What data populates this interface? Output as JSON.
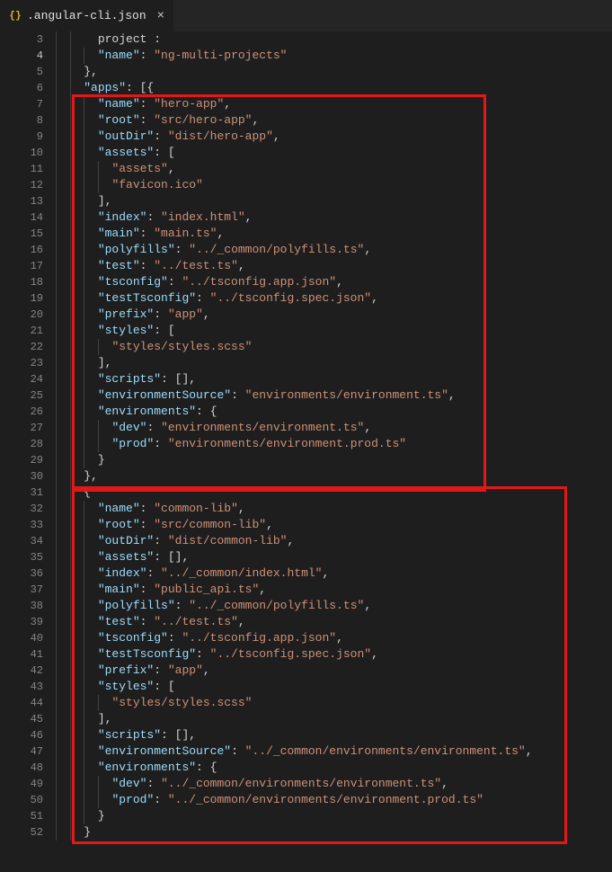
{
  "tab": {
    "icon_label": "{}",
    "filename": ".angular-cli.json",
    "close_glyph": "×"
  },
  "line_numbers_start": 3,
  "highlighted_gutter": 4,
  "lines": [
    {
      "n": 3,
      "ind": 2,
      "segs": [
        [
          "  ",
          null
        ],
        [
          "project",
          null
        ],
        [
          " : ",
          null
        ]
      ]
    },
    {
      "n": 4,
      "ind": 3,
      "segs": [
        [
          "\"name\"",
          "key"
        ],
        [
          ": ",
          "punct"
        ],
        [
          "\"ng-multi-projects\"",
          "str"
        ]
      ]
    },
    {
      "n": 5,
      "ind": 2,
      "segs": [
        [
          "},",
          "punct"
        ]
      ]
    },
    {
      "n": 6,
      "ind": 2,
      "segs": [
        [
          "\"apps\"",
          "key"
        ],
        [
          ": [{",
          "punct"
        ]
      ]
    },
    {
      "n": 7,
      "ind": 3,
      "segs": [
        [
          "\"name\"",
          "key"
        ],
        [
          ": ",
          "punct"
        ],
        [
          "\"hero-app\"",
          "str"
        ],
        [
          ",",
          "punct"
        ]
      ]
    },
    {
      "n": 8,
      "ind": 3,
      "segs": [
        [
          "\"root\"",
          "key"
        ],
        [
          ": ",
          "punct"
        ],
        [
          "\"src/hero-app\"",
          "str"
        ],
        [
          ",",
          "punct"
        ]
      ]
    },
    {
      "n": 9,
      "ind": 3,
      "segs": [
        [
          "\"outDir\"",
          "key"
        ],
        [
          ": ",
          "punct"
        ],
        [
          "\"dist/hero-app\"",
          "str"
        ],
        [
          ",",
          "punct"
        ]
      ]
    },
    {
      "n": 10,
      "ind": 3,
      "segs": [
        [
          "\"assets\"",
          "key"
        ],
        [
          ": [",
          "punct"
        ]
      ]
    },
    {
      "n": 11,
      "ind": 4,
      "segs": [
        [
          "\"assets\"",
          "str"
        ],
        [
          ",",
          "punct"
        ]
      ]
    },
    {
      "n": 12,
      "ind": 4,
      "segs": [
        [
          "\"favicon.ico\"",
          "str"
        ]
      ]
    },
    {
      "n": 13,
      "ind": 3,
      "segs": [
        [
          "],",
          "punct"
        ]
      ]
    },
    {
      "n": 14,
      "ind": 3,
      "segs": [
        [
          "\"index\"",
          "key"
        ],
        [
          ": ",
          "punct"
        ],
        [
          "\"index.html\"",
          "str"
        ],
        [
          ",",
          "punct"
        ]
      ]
    },
    {
      "n": 15,
      "ind": 3,
      "segs": [
        [
          "\"main\"",
          "key"
        ],
        [
          ": ",
          "punct"
        ],
        [
          "\"main.ts\"",
          "str"
        ],
        [
          ",",
          "punct"
        ]
      ]
    },
    {
      "n": 16,
      "ind": 3,
      "segs": [
        [
          "\"polyfills\"",
          "key"
        ],
        [
          ": ",
          "punct"
        ],
        [
          "\"../_common/polyfills.ts\"",
          "str"
        ],
        [
          ",",
          "punct"
        ]
      ]
    },
    {
      "n": 17,
      "ind": 3,
      "segs": [
        [
          "\"test\"",
          "key"
        ],
        [
          ": ",
          "punct"
        ],
        [
          "\"../test.ts\"",
          "str"
        ],
        [
          ",",
          "punct"
        ]
      ]
    },
    {
      "n": 18,
      "ind": 3,
      "segs": [
        [
          "\"tsconfig\"",
          "key"
        ],
        [
          ": ",
          "punct"
        ],
        [
          "\"../tsconfig.app.json\"",
          "str"
        ],
        [
          ",",
          "punct"
        ]
      ]
    },
    {
      "n": 19,
      "ind": 3,
      "segs": [
        [
          "\"testTsconfig\"",
          "key"
        ],
        [
          ": ",
          "punct"
        ],
        [
          "\"../tsconfig.spec.json\"",
          "str"
        ],
        [
          ",",
          "punct"
        ]
      ]
    },
    {
      "n": 20,
      "ind": 3,
      "segs": [
        [
          "\"prefix\"",
          "key"
        ],
        [
          ": ",
          "punct"
        ],
        [
          "\"app\"",
          "str"
        ],
        [
          ",",
          "punct"
        ]
      ]
    },
    {
      "n": 21,
      "ind": 3,
      "segs": [
        [
          "\"styles\"",
          "key"
        ],
        [
          ": [",
          "punct"
        ]
      ]
    },
    {
      "n": 22,
      "ind": 4,
      "segs": [
        [
          "\"styles/styles.scss\"",
          "str"
        ]
      ]
    },
    {
      "n": 23,
      "ind": 3,
      "segs": [
        [
          "],",
          "punct"
        ]
      ]
    },
    {
      "n": 24,
      "ind": 3,
      "segs": [
        [
          "\"scripts\"",
          "key"
        ],
        [
          ": [],",
          "punct"
        ]
      ]
    },
    {
      "n": 25,
      "ind": 3,
      "segs": [
        [
          "\"environmentSource\"",
          "key"
        ],
        [
          ": ",
          "punct"
        ],
        [
          "\"environments/environment.ts\"",
          "str"
        ],
        [
          ",",
          "punct"
        ]
      ]
    },
    {
      "n": 26,
      "ind": 3,
      "segs": [
        [
          "\"environments\"",
          "key"
        ],
        [
          ": {",
          "punct"
        ]
      ]
    },
    {
      "n": 27,
      "ind": 4,
      "segs": [
        [
          "\"dev\"",
          "key"
        ],
        [
          ": ",
          "punct"
        ],
        [
          "\"environments/environment.ts\"",
          "str"
        ],
        [
          ",",
          "punct"
        ]
      ]
    },
    {
      "n": 28,
      "ind": 4,
      "segs": [
        [
          "\"prod\"",
          "key"
        ],
        [
          ": ",
          "punct"
        ],
        [
          "\"environments/environment.prod.ts\"",
          "str"
        ]
      ]
    },
    {
      "n": 29,
      "ind": 3,
      "segs": [
        [
          "}",
          "punct"
        ]
      ]
    },
    {
      "n": 30,
      "ind": 2,
      "segs": [
        [
          "},",
          "punct"
        ]
      ]
    },
    {
      "n": 31,
      "ind": 2,
      "segs": [
        [
          "{",
          "punct"
        ]
      ]
    },
    {
      "n": 32,
      "ind": 3,
      "segs": [
        [
          "\"name\"",
          "key"
        ],
        [
          ": ",
          "punct"
        ],
        [
          "\"common-lib\"",
          "str"
        ],
        [
          ",",
          "punct"
        ]
      ]
    },
    {
      "n": 33,
      "ind": 3,
      "segs": [
        [
          "\"root\"",
          "key"
        ],
        [
          ": ",
          "punct"
        ],
        [
          "\"src/common-lib\"",
          "str"
        ],
        [
          ",",
          "punct"
        ]
      ]
    },
    {
      "n": 34,
      "ind": 3,
      "segs": [
        [
          "\"outDir\"",
          "key"
        ],
        [
          ": ",
          "punct"
        ],
        [
          "\"dist/common-lib\"",
          "str"
        ],
        [
          ",",
          "punct"
        ]
      ]
    },
    {
      "n": 35,
      "ind": 3,
      "segs": [
        [
          "\"assets\"",
          "key"
        ],
        [
          ": [],",
          "punct"
        ]
      ]
    },
    {
      "n": 36,
      "ind": 3,
      "segs": [
        [
          "\"index\"",
          "key"
        ],
        [
          ": ",
          "punct"
        ],
        [
          "\"../_common/index.html\"",
          "str"
        ],
        [
          ",",
          "punct"
        ]
      ]
    },
    {
      "n": 37,
      "ind": 3,
      "segs": [
        [
          "\"main\"",
          "key"
        ],
        [
          ": ",
          "punct"
        ],
        [
          "\"public_api.ts\"",
          "str"
        ],
        [
          ",",
          "punct"
        ]
      ]
    },
    {
      "n": 38,
      "ind": 3,
      "segs": [
        [
          "\"polyfills\"",
          "key"
        ],
        [
          ": ",
          "punct"
        ],
        [
          "\"../_common/polyfills.ts\"",
          "str"
        ],
        [
          ",",
          "punct"
        ]
      ]
    },
    {
      "n": 39,
      "ind": 3,
      "segs": [
        [
          "\"test\"",
          "key"
        ],
        [
          ": ",
          "punct"
        ],
        [
          "\"../test.ts\"",
          "str"
        ],
        [
          ",",
          "punct"
        ]
      ]
    },
    {
      "n": 40,
      "ind": 3,
      "segs": [
        [
          "\"tsconfig\"",
          "key"
        ],
        [
          ": ",
          "punct"
        ],
        [
          "\"../tsconfig.app.json\"",
          "str"
        ],
        [
          ",",
          "punct"
        ]
      ]
    },
    {
      "n": 41,
      "ind": 3,
      "segs": [
        [
          "\"testTsconfig\"",
          "key"
        ],
        [
          ": ",
          "punct"
        ],
        [
          "\"../tsconfig.spec.json\"",
          "str"
        ],
        [
          ",",
          "punct"
        ]
      ]
    },
    {
      "n": 42,
      "ind": 3,
      "segs": [
        [
          "\"prefix\"",
          "key"
        ],
        [
          ": ",
          "punct"
        ],
        [
          "\"app\"",
          "str"
        ],
        [
          ",",
          "punct"
        ]
      ]
    },
    {
      "n": 43,
      "ind": 3,
      "segs": [
        [
          "\"styles\"",
          "key"
        ],
        [
          ": [",
          "punct"
        ]
      ]
    },
    {
      "n": 44,
      "ind": 4,
      "segs": [
        [
          "\"styles/styles.scss\"",
          "str"
        ]
      ]
    },
    {
      "n": 45,
      "ind": 3,
      "segs": [
        [
          "],",
          "punct"
        ]
      ]
    },
    {
      "n": 46,
      "ind": 3,
      "segs": [
        [
          "\"scripts\"",
          "key"
        ],
        [
          ": [],",
          "punct"
        ]
      ]
    },
    {
      "n": 47,
      "ind": 3,
      "segs": [
        [
          "\"environmentSource\"",
          "key"
        ],
        [
          ": ",
          "punct"
        ],
        [
          "\"../_common/environments/environment.ts\"",
          "str"
        ],
        [
          ",",
          "punct"
        ]
      ]
    },
    {
      "n": 48,
      "ind": 3,
      "segs": [
        [
          "\"environments\"",
          "key"
        ],
        [
          ": {",
          "punct"
        ]
      ]
    },
    {
      "n": 49,
      "ind": 4,
      "segs": [
        [
          "\"dev\"",
          "key"
        ],
        [
          ": ",
          "punct"
        ],
        [
          "\"../_common/environments/environment.ts\"",
          "str"
        ],
        [
          ",",
          "punct"
        ]
      ]
    },
    {
      "n": 50,
      "ind": 4,
      "segs": [
        [
          "\"prod\"",
          "key"
        ],
        [
          ": ",
          "punct"
        ],
        [
          "\"../_common/environments/environment.prod.ts\"",
          "str"
        ]
      ]
    },
    {
      "n": 51,
      "ind": 3,
      "segs": [
        [
          "}",
          "punct"
        ]
      ]
    },
    {
      "n": 52,
      "ind": 2,
      "segs": [
        [
          "}",
          "punct"
        ]
      ]
    }
  ],
  "highlights": [
    {
      "id": 1
    },
    {
      "id": 2
    }
  ]
}
